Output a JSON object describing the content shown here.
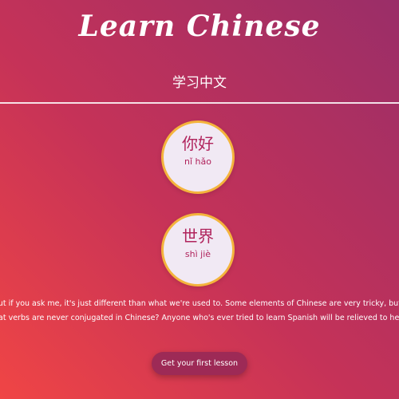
{
  "header": {
    "title": "Learn Chinese",
    "subtitle": "学习中文"
  },
  "words": [
    {
      "hanzi": "你好",
      "pinyin": "nǐ hǎo"
    },
    {
      "hanzi": "世界",
      "pinyin": "shì jiè"
    }
  ],
  "body": {
    "line1": "out if you ask me, it's just different than what we're used to. Some elements of Chinese are very tricky, but some",
    "line2": "hat verbs are never conjugated in Chinese? Anyone who's ever tried to learn Spanish will be relieved to hear that"
  },
  "cta": {
    "label": "Get your first lesson"
  },
  "colors": {
    "gradient_start": "#f04545",
    "gradient_mid": "#c53258",
    "gradient_end": "#9a2e68",
    "card_bg": "#f1e9f4",
    "card_border": "#f4b43c",
    "card_text": "#b0235c",
    "button_bg": "#9d2a56"
  }
}
